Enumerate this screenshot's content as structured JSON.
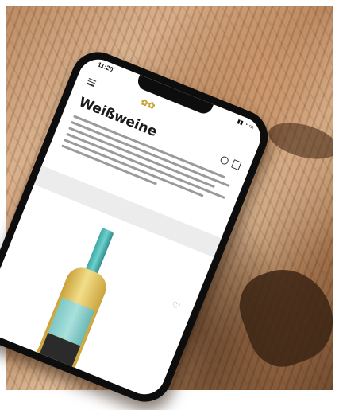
{
  "status": {
    "time": "11:20",
    "icons": "▮▮ ◔ ▭"
  },
  "header": {
    "logo_mark": "✿✿",
    "logo_text": "",
    "heading": "Weißweine"
  },
  "listing": {
    "filter_label": "",
    "sort_label": ""
  },
  "icons": {
    "menu": "menu-icon",
    "search": "search-icon",
    "bag": "shopping-bag-icon",
    "favorite": "heart-icon"
  },
  "colors": {
    "accent": "#c9a43a",
    "bottle_glass": "#3fa7a6"
  }
}
